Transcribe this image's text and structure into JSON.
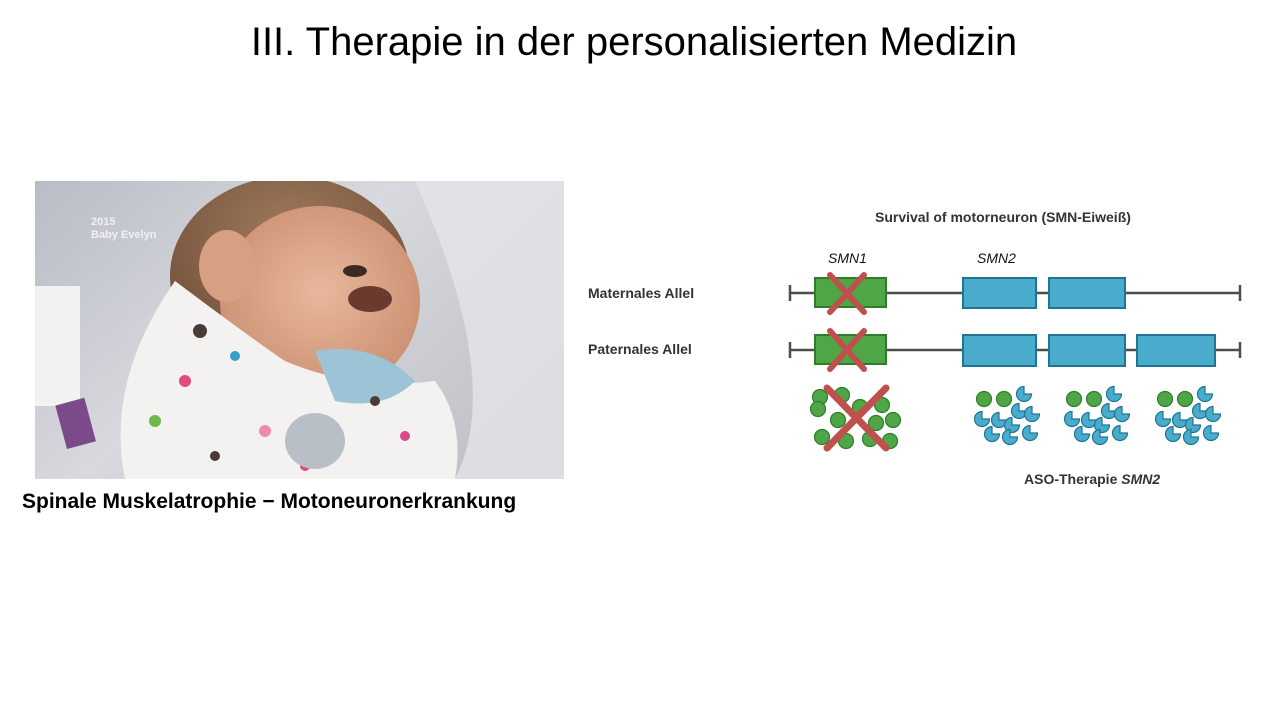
{
  "slide": {
    "title": "III. Therapie in der personalisierten Medizin",
    "caption": "Spinale Muskelatrophie − Motoneuronerkrankung"
  },
  "photo": {
    "watermark_line1": "2015",
    "watermark_line2": "Baby Evelyn"
  },
  "diagram": {
    "title": "Survival of motorneuron (SMN-Eiweiß)",
    "gene1_label": "SMN1",
    "gene2_label": "SMN2",
    "maternal_label": "Maternales Allel",
    "paternal_label": "Paternales Allel",
    "therapy_label_prefix": "ASO-Therapie ",
    "therapy_label_gene": "SMN2",
    "colors": {
      "smn1_fill": "#4ea646",
      "smn1_stroke": "#2f7d2a",
      "smn2_fill": "#4aaccc",
      "smn2_stroke": "#1f7592",
      "cross": "#c0504d",
      "line": "#4d4d4d"
    }
  }
}
